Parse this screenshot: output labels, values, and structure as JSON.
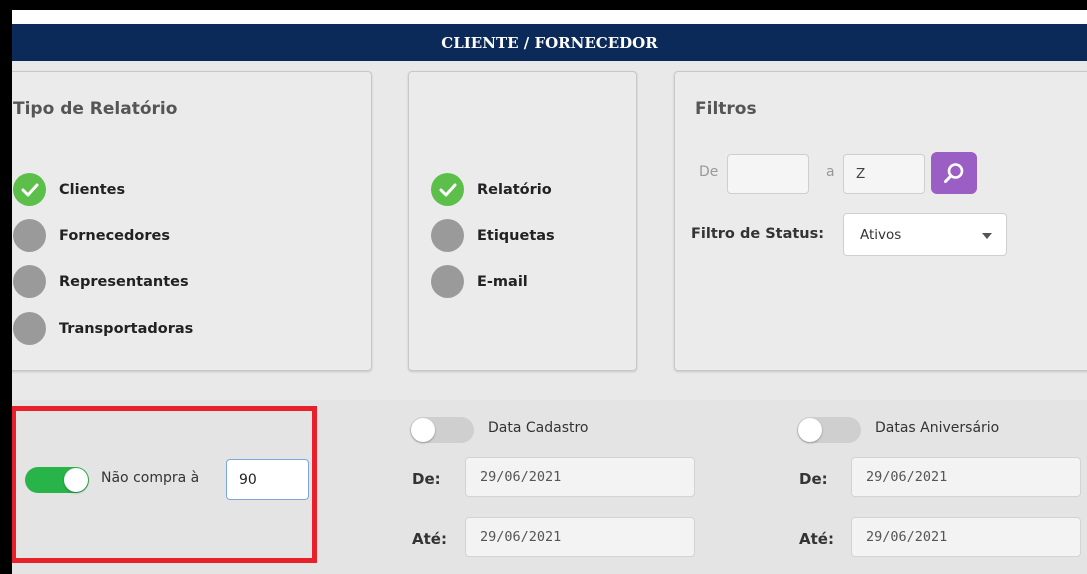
{
  "header": {
    "title": "CLIENTE / FORNECEDOR"
  },
  "tipo_relatorio": {
    "title": "Tipo de Relatório",
    "options": [
      {
        "label": "Clientes",
        "checked": true
      },
      {
        "label": "Fornecedores",
        "checked": false
      },
      {
        "label": "Representantes",
        "checked": false
      },
      {
        "label": "Transportadoras",
        "checked": false
      }
    ]
  },
  "saida": {
    "options": [
      {
        "label": "Relatório",
        "checked": true
      },
      {
        "label": "Etiquetas",
        "checked": false
      },
      {
        "label": "E-mail",
        "checked": false
      }
    ]
  },
  "filtros": {
    "title": "Filtros",
    "de_label": "De",
    "de_value": "",
    "a_label": "a",
    "a_value": "Z",
    "status_label": "Filtro de Status:",
    "status_value": "Ativos"
  },
  "nao_compra": {
    "label": "Não compra à",
    "value": "90",
    "enabled": true
  },
  "data_cadastro": {
    "label": "Data Cadastro",
    "enabled": false,
    "de_label": "De:",
    "de_value": "29/06/2021",
    "ate_label": "Até:",
    "ate_value": "29/06/2021"
  },
  "datas_aniversario": {
    "label": "Datas Aniversário",
    "enabled": false,
    "de_label": "De:",
    "de_value": "29/06/2021",
    "ate_label": "Até:",
    "ate_value": "29/06/2021"
  },
  "colors": {
    "header": "#0b2a5a",
    "checked": "#5cbf4a",
    "toggle_on": "#28b449",
    "search": "#9a5ec4",
    "highlight": "#e8202a"
  }
}
